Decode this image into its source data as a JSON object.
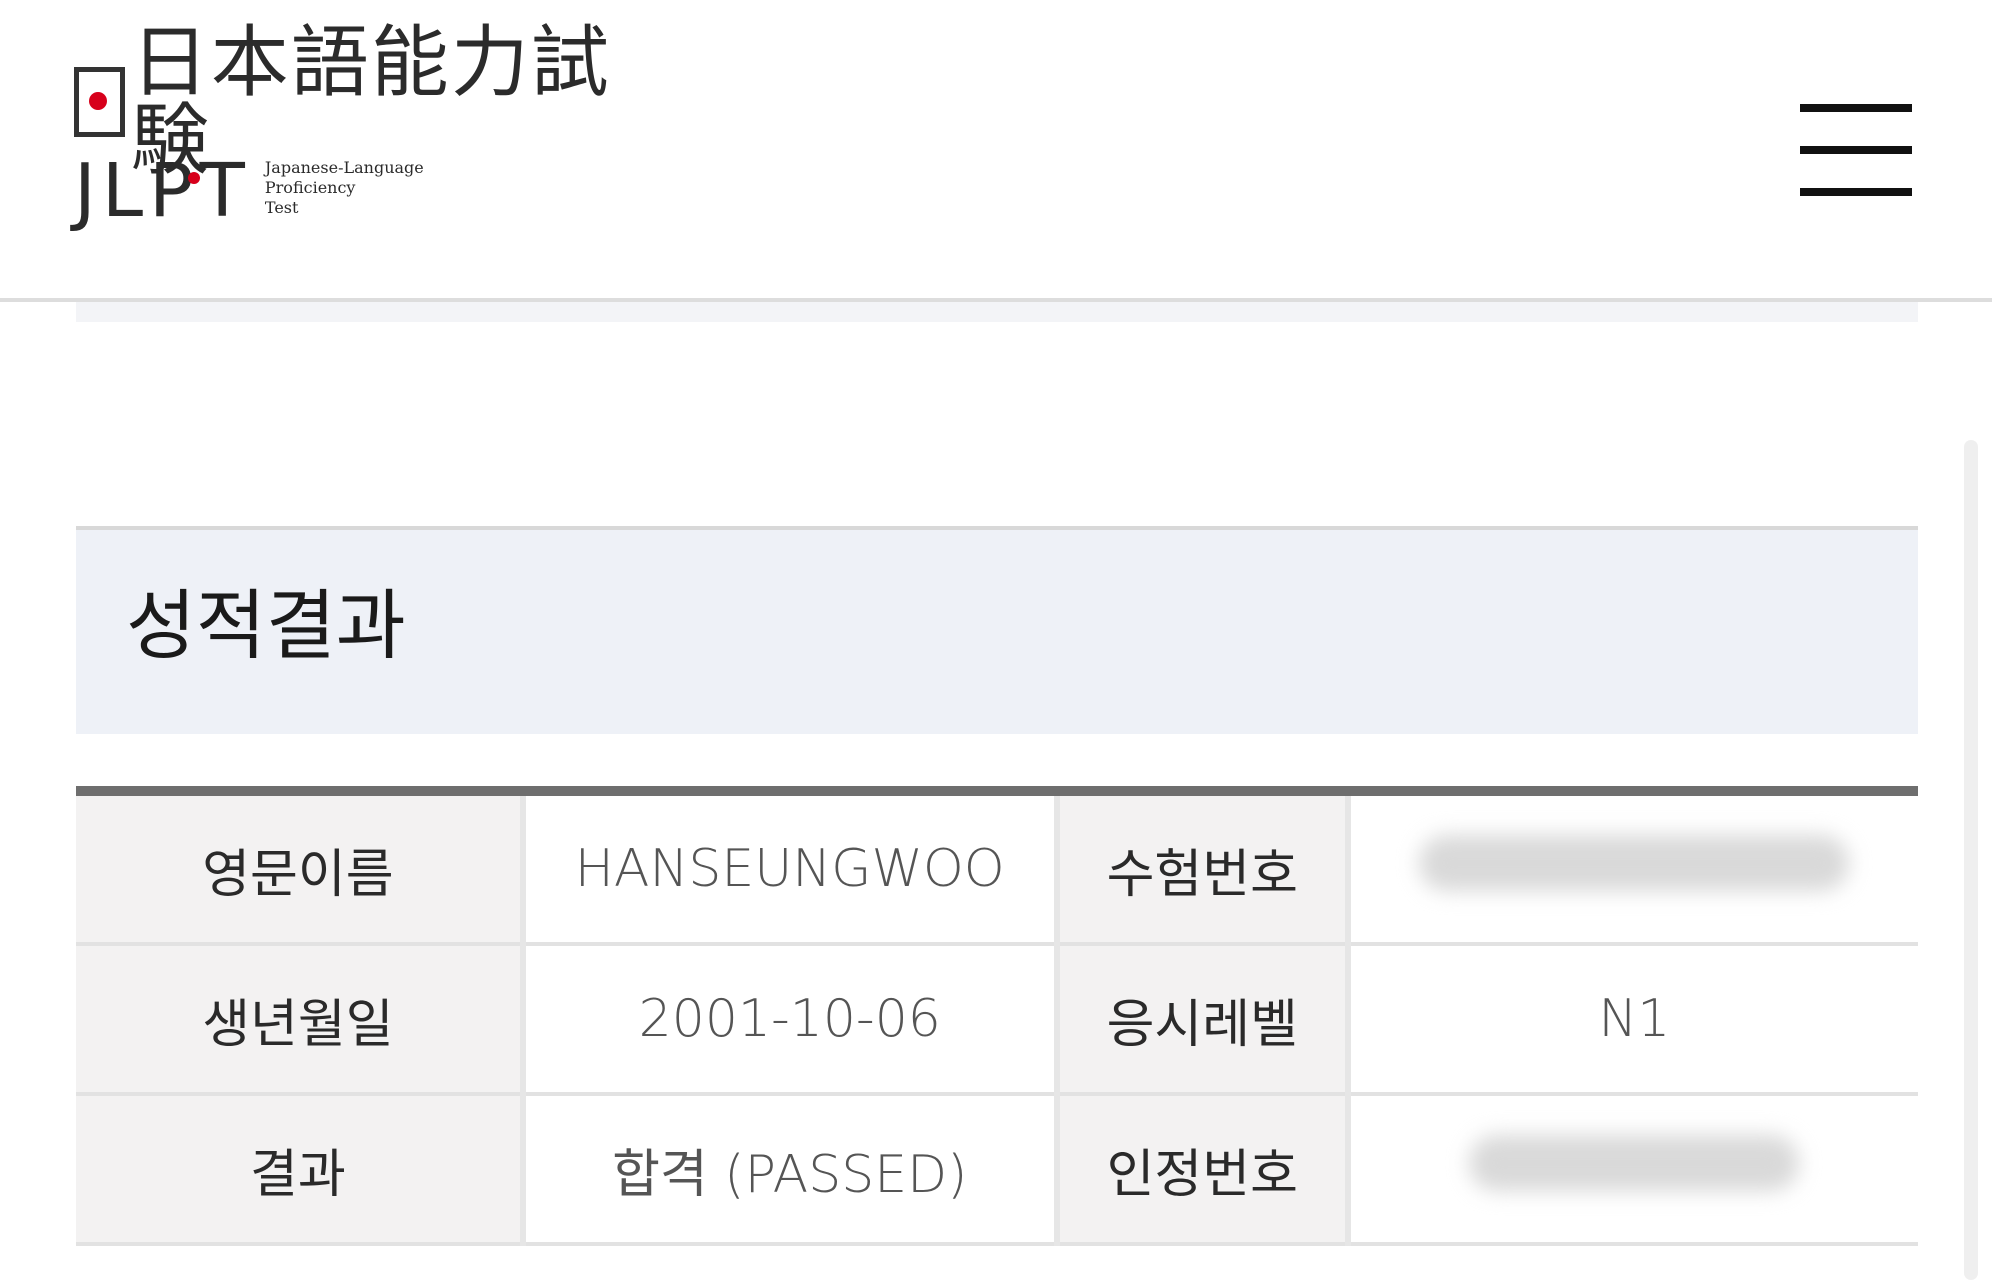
{
  "header": {
    "logo_jp_text": "日本語能力試験",
    "logo_en_text": "JLPT",
    "logo_sub_lines": [
      "Japanese-Language",
      "Proficiency",
      "Test"
    ]
  },
  "section": {
    "title": "성적결과"
  },
  "results": {
    "rows": [
      {
        "label1": "영문이름",
        "value1": "HANSEUNGWOO",
        "label2": "수험번호",
        "value2": ""
      },
      {
        "label1": "생년월일",
        "value1": "2001-10-06",
        "label2": "응시레벨",
        "value2": "N1"
      },
      {
        "label1": "결과",
        "value1": "합격 (PASSED)",
        "label2": "인정번호",
        "value2": ""
      }
    ]
  },
  "icons": {
    "menu": "hamburger-menu-icon",
    "flag": "japan-flag-icon"
  },
  "colors": {
    "flag_red": "#d7001b",
    "section_bg": "#eef1f7",
    "label_bg": "#f3f2f2",
    "table_top_border": "#6e6e6e"
  }
}
